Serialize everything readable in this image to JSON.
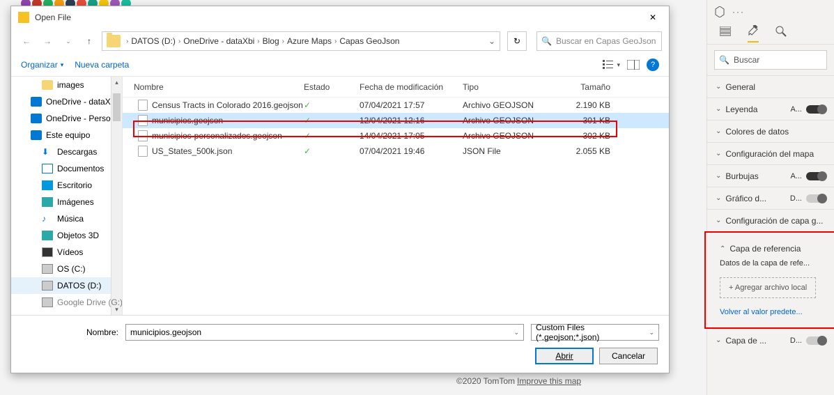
{
  "dialog": {
    "title": "Open File",
    "breadcrumb": [
      "DATOS (D:)",
      "OneDrive - dataXbi",
      "Blog",
      "Azure Maps",
      "Capas GeoJson"
    ],
    "search_placeholder": "Buscar en Capas GeoJson",
    "organize": "Organizar",
    "new_folder": "Nueva carpeta",
    "columns": {
      "name": "Nombre",
      "estado": "Estado",
      "fecha": "Fecha de modificación",
      "tipo": "Tipo",
      "tam": "Tamaño"
    },
    "sidebar": [
      {
        "label": "images",
        "icon": "folder",
        "sub": true
      },
      {
        "label": "OneDrive - dataXbi",
        "icon": "onedrive"
      },
      {
        "label": "OneDrive - Person",
        "icon": "onedrive"
      },
      {
        "label": "Este equipo",
        "icon": "pc"
      },
      {
        "label": "Descargas",
        "icon": "downloads",
        "sub": true
      },
      {
        "label": "Documentos",
        "icon": "docs",
        "sub": true
      },
      {
        "label": "Escritorio",
        "icon": "desktop",
        "sub": true
      },
      {
        "label": "Imágenes",
        "icon": "imgs",
        "sub": true
      },
      {
        "label": "Música",
        "icon": "music",
        "sub": true
      },
      {
        "label": "Objetos 3D",
        "icon": "3d",
        "sub": true
      },
      {
        "label": "Vídeos",
        "icon": "video",
        "sub": true
      },
      {
        "label": "OS (C:)",
        "icon": "disk",
        "sub": true
      },
      {
        "label": "DATOS (D:)",
        "icon": "disk",
        "sub": true,
        "sel": true
      },
      {
        "label": "Google Drive (G:)",
        "icon": "disk",
        "sub": true,
        "cut": true
      }
    ],
    "files": [
      {
        "name": "Census Tracts in Colorado 2016.geojson",
        "fecha": "07/04/2021 17:57",
        "tipo": "Archivo GEOJSON",
        "tam": "2.190 KB"
      },
      {
        "name": "municipios.geojson",
        "fecha": "12/04/2021 12:16",
        "tipo": "Archivo GEOJSON",
        "tam": "301 KB",
        "sel": true
      },
      {
        "name": "municipios-personalizados.geojson",
        "fecha": "14/04/2021 17:05",
        "tipo": "Archivo GEOJSON",
        "tam": "302 KB"
      },
      {
        "name": "US_States_500k.json",
        "fecha": "07/04/2021 19:46",
        "tipo": "JSON File",
        "tam": "2.055 KB"
      }
    ],
    "name_label": "Nombre:",
    "name_value": "municipios.geojson",
    "type_filter": "Custom Files (*.geojson;*.json)",
    "open_btn": "Abrir",
    "cancel_btn": "Cancelar"
  },
  "panel": {
    "search": "Buscar",
    "sections": {
      "general": "General",
      "leyenda": "Leyenda",
      "leyenda_val": "A...",
      "colores": "Colores de datos",
      "config_mapa": "Configuración del mapa",
      "burbujas": "Burbujas",
      "burbujas_val": "A...",
      "grafico": "Gráfico d...",
      "grafico_val": "D...",
      "config_capa": "Configuración de capa g...",
      "capa_ref": "Capa de referencia",
      "capa_ref_desc": "Datos de la capa de refe...",
      "add_file": "+ Agregar archivo local",
      "reset": "Volver al valor predete...",
      "capa_de": "Capa de ...",
      "capa_de_val": "D..."
    }
  },
  "footer": {
    "copyright": "©2020 TomTom",
    "improve": "Improve this map"
  }
}
